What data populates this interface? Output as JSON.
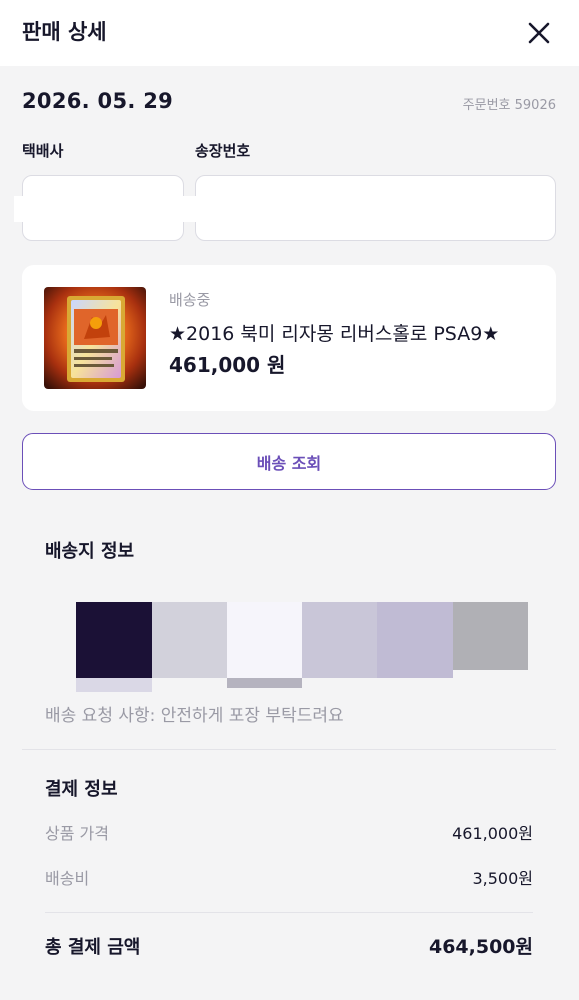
{
  "header": {
    "title": "판매 상세",
    "close_icon": "close-icon"
  },
  "order": {
    "date": "2026. 05. 29",
    "order_number": "주문번호 59026"
  },
  "shipping_fields": {
    "courier_label": "택배사",
    "tracking_label": "송장번호",
    "courier_value": "",
    "tracking_value": ""
  },
  "product": {
    "status": "배송중",
    "name": "★2016 북미 리자몽 리버스홀로 PSA9★",
    "price": "461,000 원"
  },
  "track_button_label": "배송 조회",
  "address": {
    "title": "배송지 정보",
    "request": "배송 요청 사항: 안전하게 포장 부탁드려요"
  },
  "payment": {
    "title": "결제 정보",
    "rows": [
      {
        "label": "상품 가격",
        "value": "461,000원"
      },
      {
        "label": "배송비",
        "value": "3,500원"
      }
    ],
    "total_label": "총 결제 금액",
    "total_value": "464,500원"
  },
  "colors": {
    "accent": "#6b4fb8",
    "text_primary": "#17172b",
    "text_secondary": "#9a9aa5",
    "background": "#f4f4f5"
  }
}
